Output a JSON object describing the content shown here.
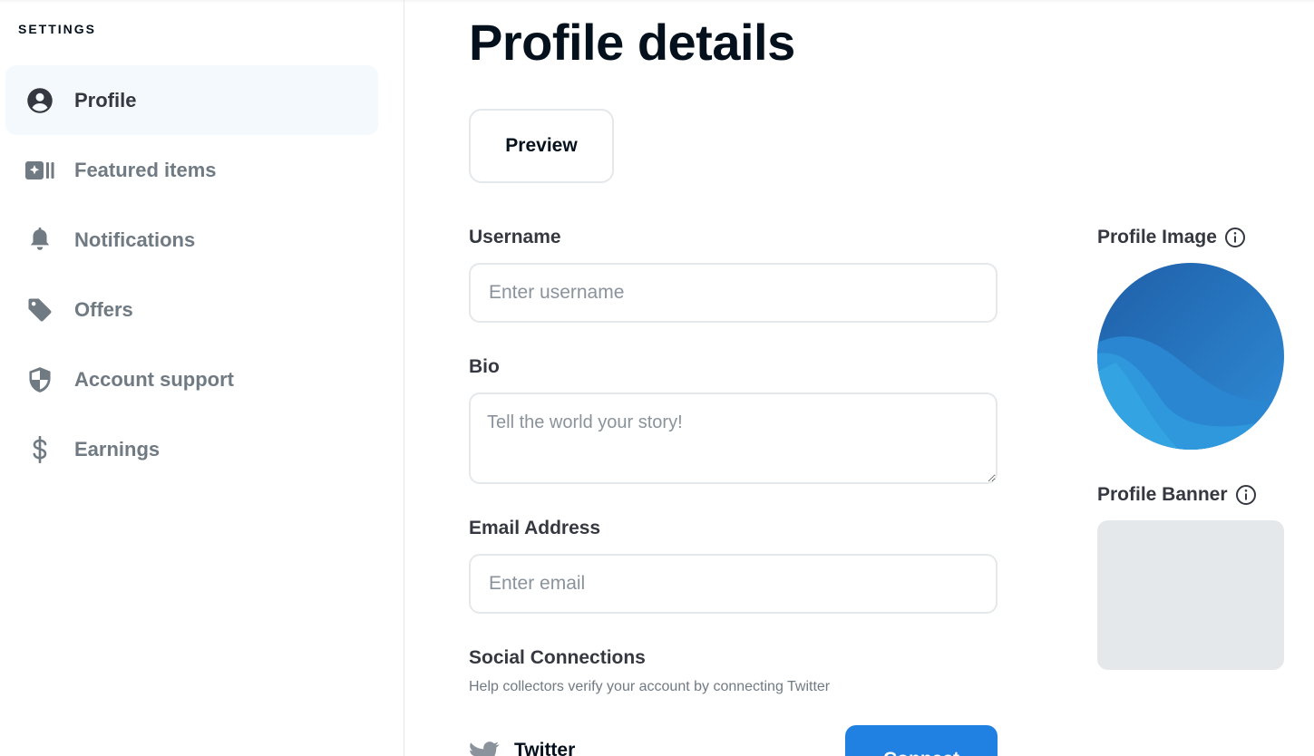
{
  "sidebar": {
    "heading": "SETTINGS",
    "items": [
      {
        "label": "Profile",
        "icon": "account-circle-icon",
        "active": true
      },
      {
        "label": "Featured items",
        "icon": "featured-items-icon",
        "active": false
      },
      {
        "label": "Notifications",
        "icon": "bell-icon",
        "active": false
      },
      {
        "label": "Offers",
        "icon": "tag-icon",
        "active": false
      },
      {
        "label": "Account support",
        "icon": "shield-icon",
        "active": false
      },
      {
        "label": "Earnings",
        "icon": "dollar-icon",
        "active": false
      }
    ]
  },
  "main": {
    "title": "Profile details",
    "preview_label": "Preview",
    "username": {
      "label": "Username",
      "value": "",
      "placeholder": "Enter username"
    },
    "bio": {
      "label": "Bio",
      "value": "",
      "placeholder": "Tell the world your story!"
    },
    "email": {
      "label": "Email Address",
      "value": "",
      "placeholder": "Enter email"
    },
    "social": {
      "label": "Social Connections",
      "help": "Help collectors verify your account by connecting Twitter",
      "twitter_label": "Twitter",
      "connect_label": "Connect"
    }
  },
  "side": {
    "profile_image_label": "Profile Image",
    "profile_banner_label": "Profile Banner"
  },
  "colors": {
    "accent": "#2081e2",
    "active_bg": "#f3f9fd",
    "muted_text": "#707a83",
    "border": "#e5e8eb",
    "banner_placeholder": "#e5e8eb"
  }
}
